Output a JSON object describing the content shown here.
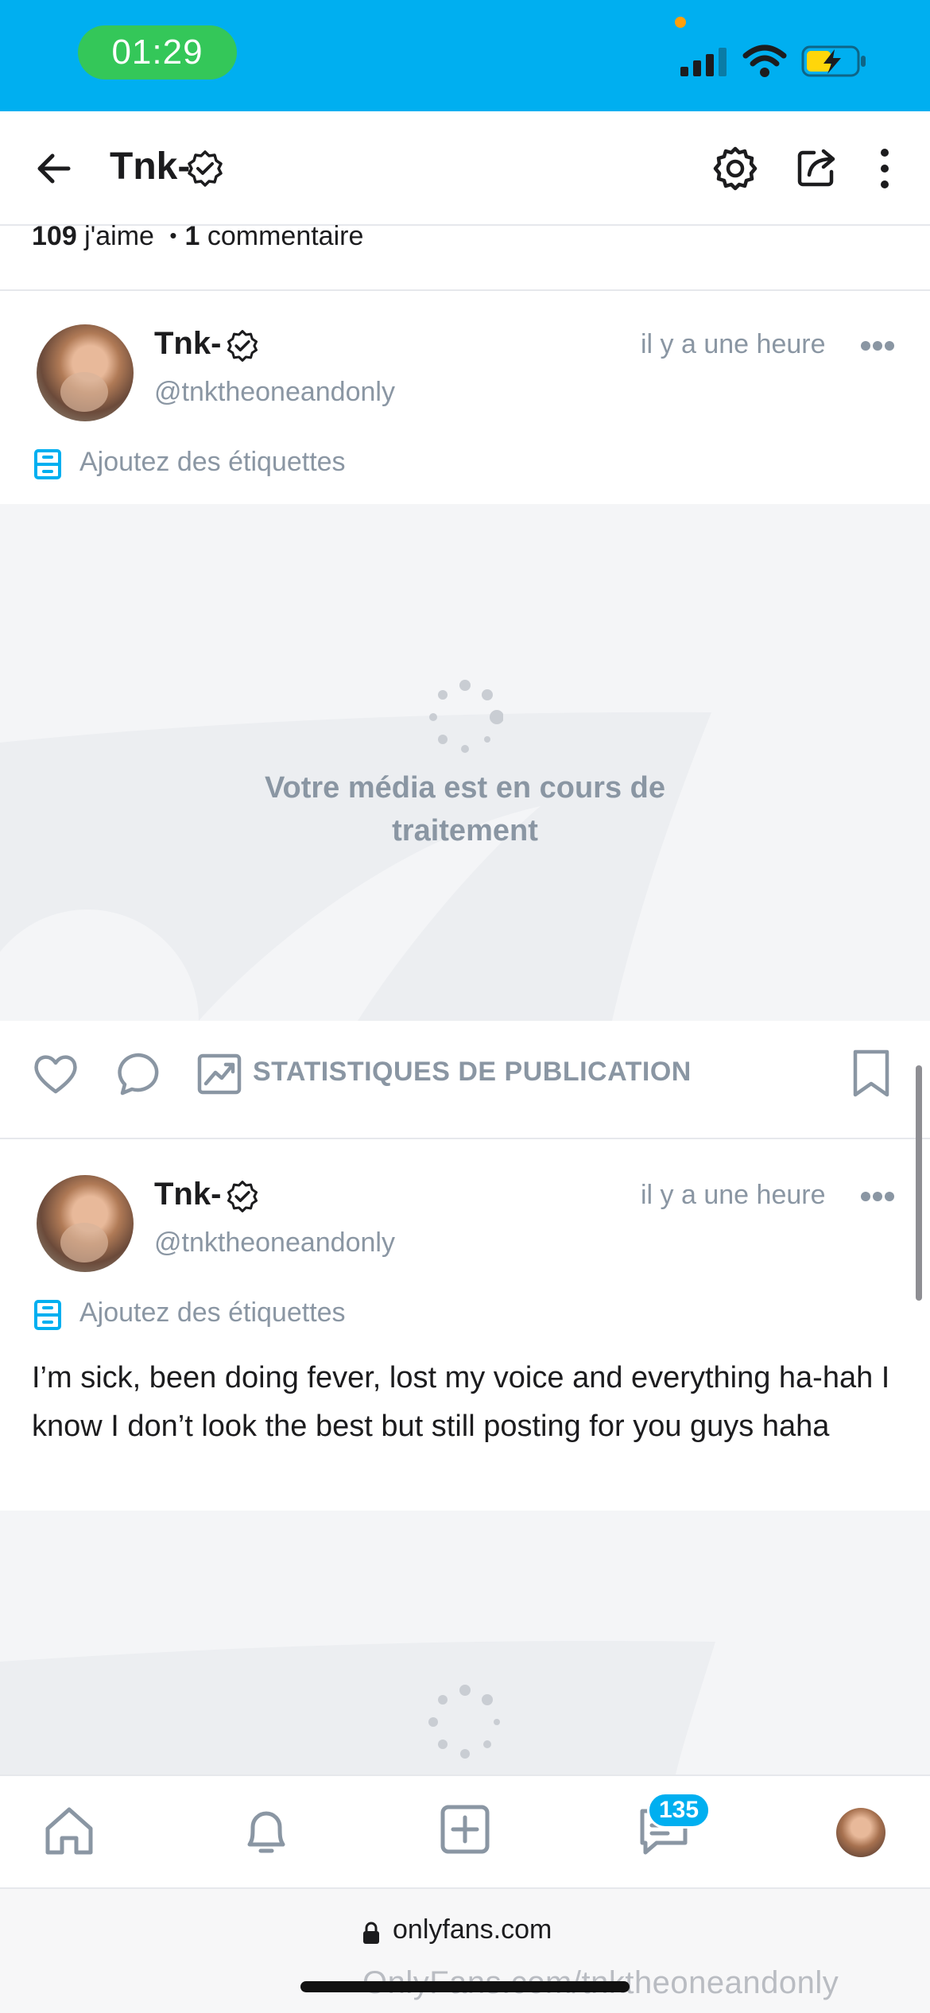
{
  "status_bar": {
    "time": "01:29"
  },
  "header": {
    "title": "Tnk-"
  },
  "previous_post": {
    "likes_count": "109",
    "likes_label": " j'aime",
    "bullet": "•",
    "comments_count": "1",
    "comments_label": " commentaire"
  },
  "posts": [
    {
      "author": "Tnk-",
      "handle": "@tnktheoneandonly",
      "time_ago": "il y a une heure",
      "tags_prompt": "Ajoutez des étiquettes",
      "media_status": "Votre média est en cours de traitement",
      "actions": {
        "stats_label": "STATISTIQUES DE PUBLICATION"
      }
    },
    {
      "author": "Tnk-",
      "handle": "@tnktheoneandonly",
      "time_ago": "il y a une heure",
      "tags_prompt": "Ajoutez des étiquettes",
      "text": "I’m sick, been doing fever, lost my voice and everything ha-hah I know I don’t look the best but still posting for you guys haha"
    }
  ],
  "bottom_nav": {
    "messages_badge": "135"
  },
  "browser": {
    "url": "onlyfans.com",
    "watermark": "OnlyFans.com/tnktheoneandonly"
  },
  "colors": {
    "brand": "#00aff0",
    "muted": "#8a96a3",
    "time_pill": "#34c759"
  },
  "icons": [
    "back-arrow-icon",
    "verified-icon",
    "gear-icon",
    "share-icon",
    "kebab-icon",
    "tag-icon",
    "more-icon",
    "heart-icon",
    "comment-icon",
    "stats-icon",
    "bookmark-icon",
    "home-icon",
    "bell-icon",
    "add-icon",
    "messages-icon",
    "lock-icon"
  ]
}
